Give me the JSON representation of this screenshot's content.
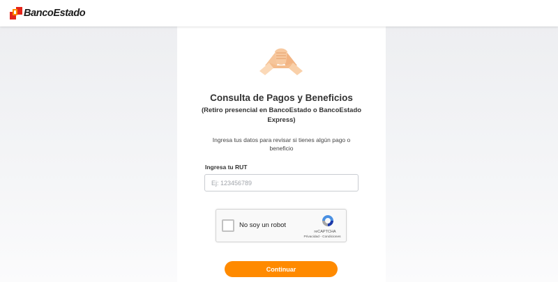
{
  "header": {
    "brand": "BancoEstado"
  },
  "card": {
    "title": "Consulta de Pagos y Beneficios",
    "subtitle": "(Retiro presencial en BancoEstado o BancoEstado Express)",
    "description": "Ingresa tus datos para revisar si tienes algún pago o beneficio",
    "rut_label": "Ingresa tu RUT",
    "rut_placeholder": "Ej: 123456789",
    "rut_value": "",
    "continue_label": "Continuar"
  },
  "captcha": {
    "label": "No soy un robot",
    "brand": "reCAPTCHA",
    "links": "Privacidad - Condiciones",
    "checked": false
  },
  "colors": {
    "accent": "#ff8a00",
    "brand_red": "#e4251b",
    "text": "#333333"
  },
  "icons": {
    "logo": "bancoestado-logo-icon",
    "hands": "handshake-icon",
    "captcha": "recaptcha-icon"
  }
}
